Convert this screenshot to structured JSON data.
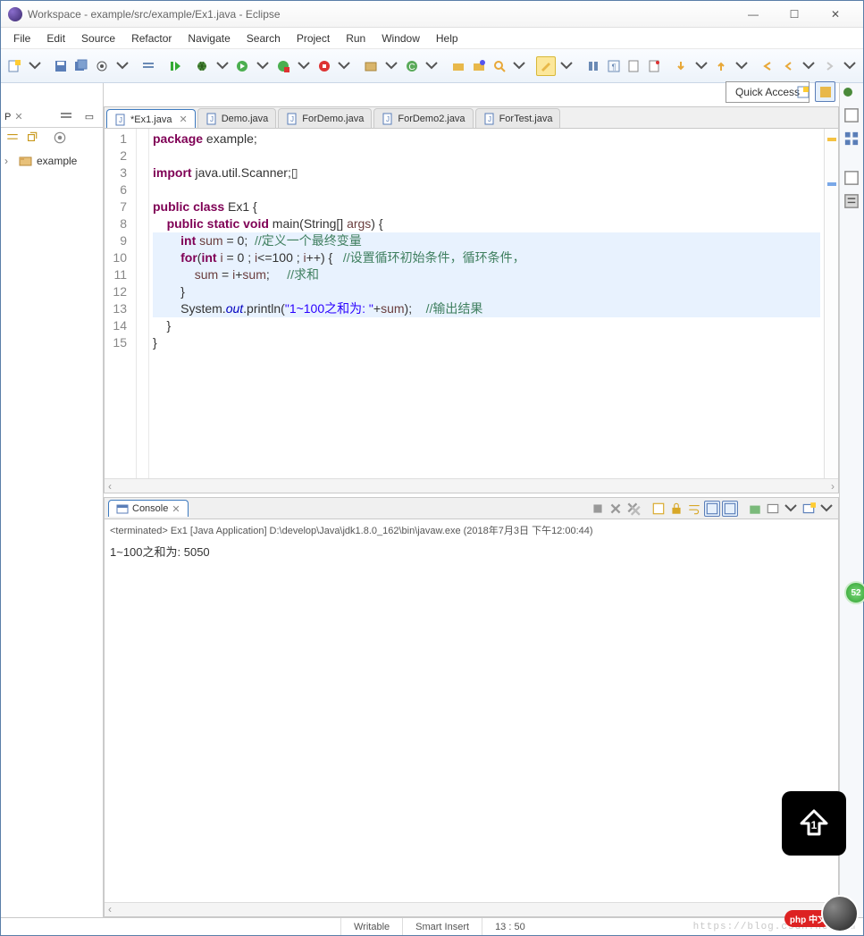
{
  "window": {
    "title": "Workspace - example/src/example/Ex1.java - Eclipse"
  },
  "menu": [
    "File",
    "Edit",
    "Source",
    "Refactor",
    "Navigate",
    "Search",
    "Project",
    "Run",
    "Window",
    "Help"
  ],
  "quick_access": "Quick Access",
  "package_explorer": {
    "label": "P",
    "project": "example"
  },
  "editor": {
    "tabs": [
      {
        "label": "*Ex1.java",
        "active": true,
        "dirty": true
      },
      {
        "label": "Demo.java",
        "active": false
      },
      {
        "label": "ForDemo.java",
        "active": false
      },
      {
        "label": "ForDemo2.java",
        "active": false
      },
      {
        "label": "ForTest.java",
        "active": false
      }
    ],
    "lines": [
      {
        "n": "1",
        "html": "<span class='kw'>package</span> example;"
      },
      {
        "n": "2",
        "html": ""
      },
      {
        "n": "3",
        "html": "<span class='kw'>import</span> java.util.Scanner;▯",
        "marker": "warn-expand"
      },
      {
        "n": "6",
        "html": ""
      },
      {
        "n": "7",
        "html": "<span class='kw'>public class</span> Ex1 {"
      },
      {
        "n": "8",
        "html": "    <span class='kw'>public static void</span> main(String[] <span class='id'>args</span>) {",
        "marker": "collapse"
      },
      {
        "n": "9",
        "html": "        <span class='kw'>int</span> <span class='id'>sum</span> = 0;  <span class='cm'>//定义一个最终变量</span>",
        "hl": true
      },
      {
        "n": "10",
        "html": "        <span class='kw'>for</span>(<span class='kw'>int</span> <span class='id'>i</span> = 0 ; <span class='id'>i</span>&lt;=100 ; <span class='id'>i</span>++) {   <span class='cm'>//设置循环初始条件，循环条件，</span>",
        "hl": true
      },
      {
        "n": "11",
        "html": "            <span class='id'>sum</span> = <span class='id'>i</span>+<span class='id'>sum</span>;     <span class='cm'>//求和</span>",
        "hl": true
      },
      {
        "n": "12",
        "html": "        }",
        "hl": true
      },
      {
        "n": "13",
        "html": "        System.<span class='fd'>out</span>.println(<span class='st'>\"1~100之和为: \"</span>+<span class='id'>sum</span>);    <span class='cm'>//输出结果</span>",
        "hl": true
      },
      {
        "n": "14",
        "html": "    }"
      },
      {
        "n": "15",
        "html": "}"
      }
    ]
  },
  "console": {
    "tab_label": "Console",
    "terminated": "<terminated> Ex1 [Java Application] D:\\develop\\Java\\jdk1.8.0_162\\bin\\javaw.exe (2018年7月3日 下午12:00:44)",
    "output": "1~100之和为: 5050"
  },
  "statusbar": {
    "writable": "Writable",
    "insert": "Smart Insert",
    "cursor": "13 : 50",
    "watermark": "https://blog.csdn.net/am"
  },
  "badges": {
    "green": "52",
    "php": "php 中文"
  }
}
